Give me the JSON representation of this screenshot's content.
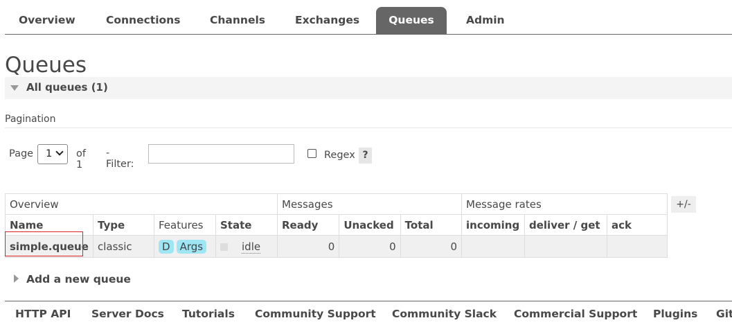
{
  "nav": {
    "tabs": [
      {
        "label": "Overview"
      },
      {
        "label": "Connections"
      },
      {
        "label": "Channels"
      },
      {
        "label": "Exchanges"
      },
      {
        "label": "Queues"
      },
      {
        "label": "Admin"
      }
    ],
    "active": "Queues"
  },
  "page": {
    "title": "Queues",
    "section_label": "All queues (1)"
  },
  "pagination": {
    "label": "Pagination",
    "page_label": "Page",
    "page_value": "1",
    "of_label": "of 1",
    "filter_label": "- Filter:",
    "filter_value": "",
    "regex_label": "Regex",
    "regex_checked": false,
    "help_label": "?"
  },
  "table": {
    "groups": [
      "Overview",
      "Messages",
      "Message rates"
    ],
    "columns": [
      "Name",
      "Type",
      "Features",
      "State",
      "Ready",
      "Unacked",
      "Total",
      "incoming",
      "deliver / get",
      "ack"
    ],
    "rows": [
      {
        "name": "simple.queue",
        "type": "classic",
        "features": [
          "D",
          "Args"
        ],
        "state": "idle",
        "ready": "0",
        "unacked": "0",
        "total": "0",
        "incoming": "",
        "deliver_get": "",
        "ack": ""
      }
    ],
    "toggle_columns_label": "+/-"
  },
  "add_queue": {
    "label": "Add a new queue"
  },
  "footer": {
    "links": [
      "HTTP API",
      "Server Docs",
      "Tutorials",
      "Community Support",
      "Community Slack",
      "Commercial Support",
      "Plugins",
      "Git"
    ]
  },
  "colors": {
    "tab_active_bg": "#666666",
    "feature_tag_bg": "#9ee6f3",
    "highlight_box": "#dd2222"
  }
}
